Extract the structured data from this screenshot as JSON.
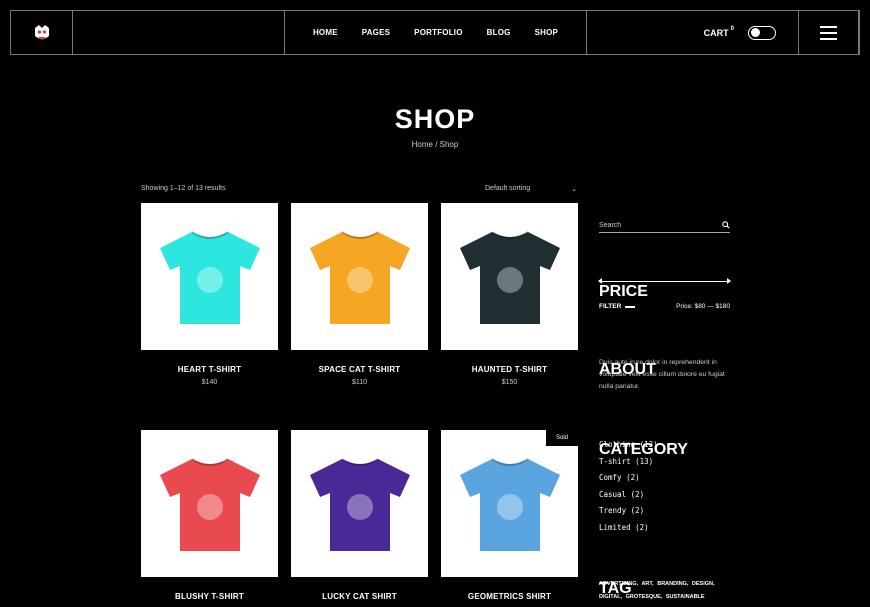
{
  "header": {
    "nav": [
      "HOME",
      "PAGES",
      "PORTFOLIO",
      "BLOG",
      "SHOP"
    ],
    "cart_label": "CART",
    "cart_count": "0"
  },
  "page": {
    "title": "SHOP",
    "breadcrumb": "Home / Shop"
  },
  "toolbar": {
    "results": "Showing 1–12 of 13 results",
    "sorting": "Default sorting"
  },
  "products": [
    {
      "name": "HEART T-SHIRT",
      "price": "$140",
      "color": "#2ee6e0"
    },
    {
      "name": "SPACE CAT T-SHIRT",
      "price": "$110",
      "color": "#f5a623"
    },
    {
      "name": "HAUNTED T-SHIRT",
      "price": "$150",
      "color": "#1f2f33"
    },
    {
      "name": "BLUSHY T-SHIRT",
      "price": "",
      "color": "#e94a4f"
    },
    {
      "name": "LUCKY CAT SHIRT",
      "price": "",
      "color": "#4a2896"
    },
    {
      "name": "GEOMETRICS SHIRT",
      "price": "",
      "color": "#5aa5e0",
      "badge": "Sold"
    }
  ],
  "sidebar": {
    "search_placeholder": "Search",
    "price_heading": "PRICE",
    "filter_label": "FILTER",
    "price_range": "Price: $80 — $180",
    "about_heading": "ABOUT",
    "about_text": "Duis aute irure dolor in reprehenderit in voluptate velit esse cillum dolore eu fugiat nulla pariatur.",
    "category_heading": "CATEGORY",
    "categories": [
      "Clothing (13)",
      "T-shirt (13)",
      "Comfy (2)",
      "Casual (2)",
      "Trendy (2)",
      "Limited (2)"
    ],
    "tag_heading": "TAG",
    "tags": [
      "ADVERTISING,",
      "ART,",
      "BRANDING,",
      "DESIGN,",
      "DIGITAL,",
      "GROTESQUE,",
      "SUSTAINABLE"
    ]
  }
}
